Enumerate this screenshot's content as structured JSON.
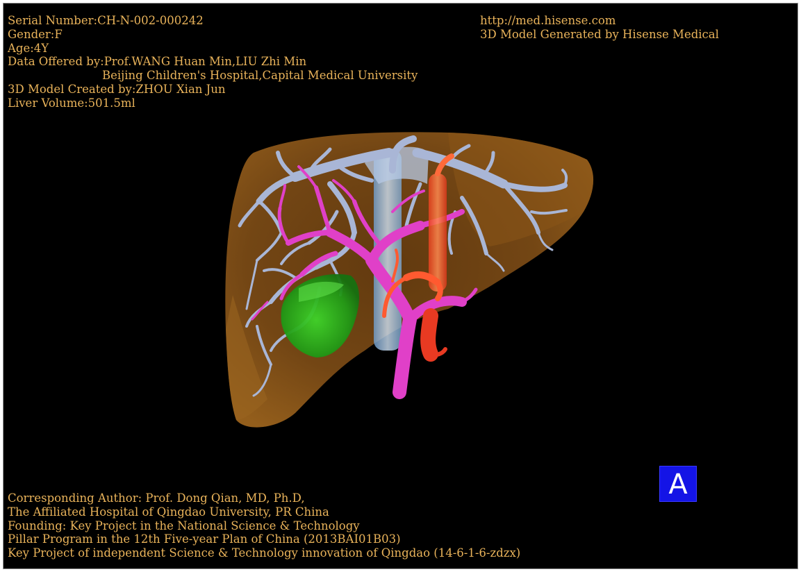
{
  "header_left": {
    "serial": "Serial Number:CH-N-002-000242",
    "gender": "Gender:F",
    "age": "Age:4Y",
    "data_offered": "Data Offered by:Prof.WANG Huan Min,LIU Zhi Min",
    "institution": "Beijing Children's Hospital,Capital Medical University",
    "model_created": "3D Model Created by:ZHOU Xian Jun",
    "liver_volume": "Liver Volume:501.5ml"
  },
  "header_right": {
    "url": "http://med.hisense.com",
    "generated_by": "3D Model Generated by Hisense Medical"
  },
  "footer_left": {
    "author": "Corresponding Author: Prof. Dong Qian, MD, Ph.D,",
    "hospital": "The Affiliated Hospital of Qingdao University, PR China",
    "founding": "Founding: Key Project in the National Science & Technology",
    "program": "Pillar Program in the 12th Five-year Plan of China (2013BAI01B03)",
    "key_project": "Key Project of independent Science & Technology innovation of Qingdao (14-6-1-6-zdzx)"
  },
  "view_badge": "A",
  "colors": {
    "text": "#e9b35a",
    "background": "#000000",
    "liver": "#7a4a14",
    "hepatic_veins": "#a9b6d6",
    "portal_vein": "#e040c8",
    "hepatic_artery": "#ff5a30",
    "gallbladder": "#2faa1f",
    "inferior_vena_cava": "#a8c8ea",
    "badge": "#1414e6"
  }
}
